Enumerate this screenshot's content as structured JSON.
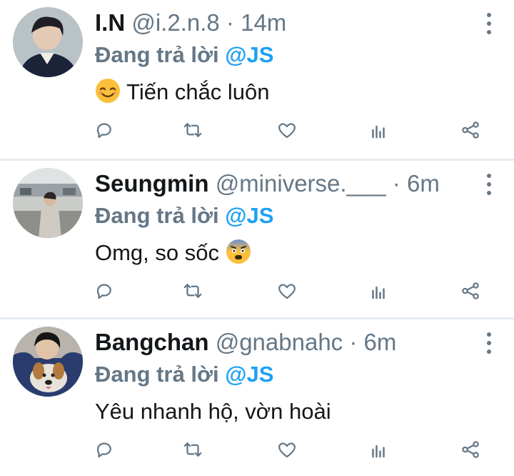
{
  "reply_label": "Đang trả lời",
  "tweets": [
    {
      "name": "I.N",
      "handle": "@i.2.n.8",
      "separator": "·",
      "time": "14m",
      "mention": "@JS",
      "text": "Tiến chắc luôn",
      "emoji": "smiling-face-emoji",
      "emoji_position": "before"
    },
    {
      "name": "Seungmin",
      "handle": "@miniverse.___",
      "separator": "·",
      "time": "6m",
      "mention": "@JS",
      "text": "Omg, so sốc",
      "emoji": "anxious-face-emoji",
      "emoji_position": "after"
    },
    {
      "name": "Bangchan",
      "handle": "@gnabnahc",
      "separator": "·",
      "time": "6m",
      "mention": "@JS",
      "text": "Yêu nhanh hộ, vờn hoài",
      "emoji": "",
      "emoji_position": "none"
    }
  ],
  "actions": [
    "reply-icon",
    "retweet-icon",
    "like-icon",
    "analytics-icon",
    "share-icon"
  ],
  "colors": {
    "accent": "#1da1f2",
    "muted": "#657786",
    "text": "#14171a",
    "divider": "#e6ecf0"
  }
}
